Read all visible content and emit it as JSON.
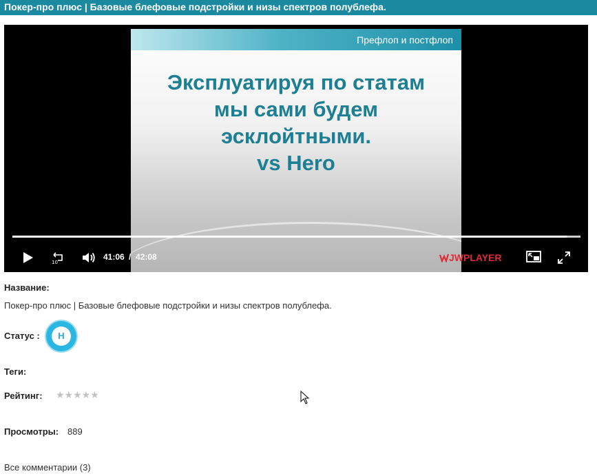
{
  "page": {
    "title": "Покер-про плюс | Базовые блефовые подстройки и низы спектров полублефа."
  },
  "player": {
    "slide": {
      "header": "Префлоп и постфлоп",
      "lines": [
        "Эксплуатируя по статам",
        "мы сами будем",
        "эсклойтными.",
        "vs Hero"
      ]
    },
    "current_time": "41:06",
    "separator": "/",
    "duration": "42:08",
    "progress_fraction": 0.9756,
    "brand": "JWPLAYER",
    "rewind_seconds": "10",
    "icons": {
      "play": "play-icon",
      "rewind": "rewind-10-icon",
      "volume": "volume-icon",
      "pip": "picture-in-picture-icon",
      "fullscreen": "fullscreen-icon"
    },
    "accent_color": "#e02b37"
  },
  "details": {
    "name_label": "Название:",
    "name_value": "Покер-про плюс | Базовые блефовые подстройки и низы спектров полублефа.",
    "status_label": "Статус :",
    "status_badge": "Н",
    "tags_label": "Теги:",
    "rating_label": "Рейтинг:",
    "rating_value": 0,
    "rating_max": 5,
    "rating_stars": "★★★★★",
    "views_label": "Просмотры:",
    "views_value": "889",
    "comments_link": "Все комментарии (3)"
  },
  "colors": {
    "titlebar": "#1b8aa0",
    "slide_text": "#1d7f93",
    "status_badge": "#2bb7e4"
  }
}
